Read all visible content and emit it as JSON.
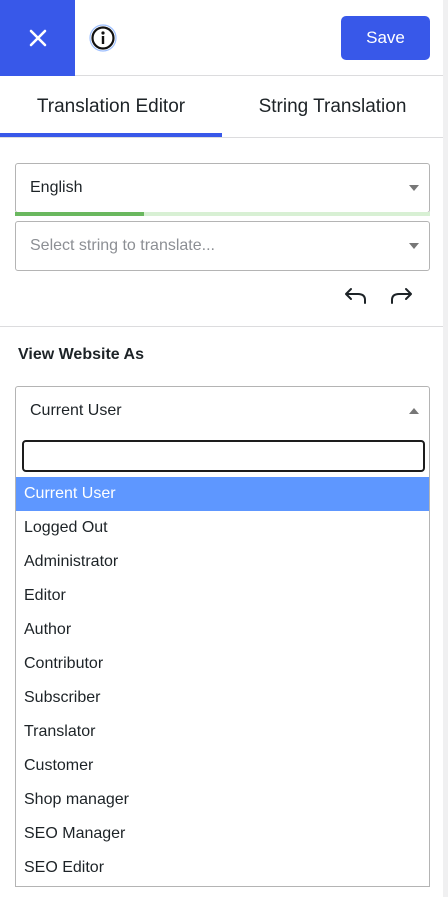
{
  "header": {
    "save_label": "Save"
  },
  "tabs": [
    {
      "label": "Translation Editor"
    },
    {
      "label": "String Translation"
    }
  ],
  "language_select": {
    "value": "English",
    "progress": 0.31
  },
  "string_select": {
    "placeholder": "Select string to translate..."
  },
  "view_as": {
    "title": "View Website As",
    "value": "Current User",
    "search_value": "",
    "options": [
      "Current User",
      "Logged Out",
      "Administrator",
      "Editor",
      "Author",
      "Contributor",
      "Subscriber",
      "Translator",
      "Customer",
      "Shop manager",
      "SEO Manager",
      "SEO Editor"
    ],
    "selected_index": 0
  },
  "colors": {
    "accent": "#3858e9",
    "highlight": "#5e97ff",
    "progress": "#6ab85f"
  }
}
